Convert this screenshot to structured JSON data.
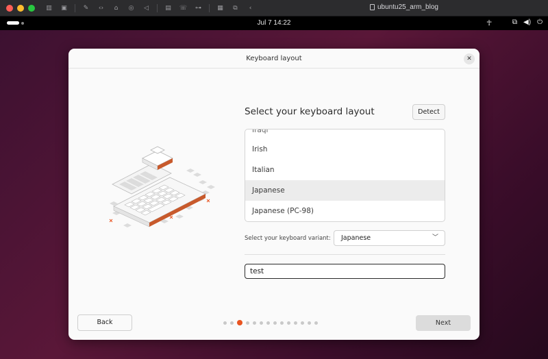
{
  "vm_toolbar": {
    "title": "ubuntu25_arm_blog",
    "icons": [
      "sidebar-icon",
      "snapshot-icon",
      "wrench-icon",
      "code-icon",
      "drive-icon",
      "camera-icon",
      "speaker-icon",
      "storage-icon",
      "phone-icon",
      "usb-icon",
      "archive-icon",
      "share-icon",
      "back-icon"
    ]
  },
  "topbar": {
    "clock": "Jul 7  14:22",
    "tray_icons": [
      "accessibility-icon",
      "network-icon",
      "volume-icon",
      "power-icon"
    ]
  },
  "dialog": {
    "title": "Keyboard layout",
    "heading": "Select your keyboard layout",
    "detect_label": "Detect",
    "layouts": [
      {
        "label": "Iraqi",
        "state": "partial"
      },
      {
        "label": "Irish",
        "state": "normal"
      },
      {
        "label": "Italian",
        "state": "normal"
      },
      {
        "label": "Japanese",
        "state": "selected"
      },
      {
        "label": "Japanese (PC-98)",
        "state": "normal"
      }
    ],
    "variant_label": "Select your keyboard variant:",
    "variant_value": "Japanese",
    "test_value": "test",
    "back_label": "Back",
    "next_label": "Next",
    "pager": {
      "total": 14,
      "current": 3
    }
  },
  "colors": {
    "accent": "#e95420",
    "dialog_bg": "#fafafa",
    "selected_row": "#ececec"
  }
}
